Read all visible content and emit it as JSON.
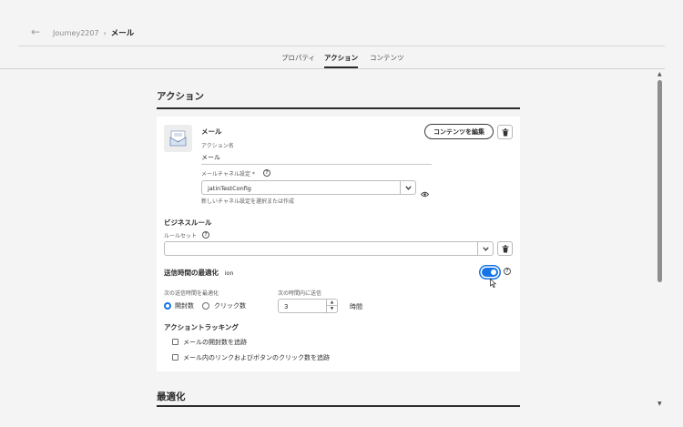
{
  "header": {
    "back_icon": "arrow-left-icon",
    "breadcrumb_parent": "Journey2207",
    "breadcrumb_sep": "›",
    "breadcrumb_current": "メール"
  },
  "tabs": [
    "プロパティ",
    "アクション",
    "コンテンツ"
  ],
  "active_tab": "アクション",
  "action_section": {
    "title": "アクション",
    "email_title": "メール",
    "action_name_label": "アクション名",
    "action_name_value": "メール",
    "channel_label": "メールチャネル設定",
    "required_mark": "*",
    "channel_value": "jatinTestConfig",
    "channel_helper": "新しいチャネル設定を選択または作成",
    "edit_content_button": "コンテンツを編集",
    "business_rules_title": "ビジネスルール",
    "ruleset_label": "ルールセット",
    "ruleset_value": "",
    "send_time_title": "送信時間の最適化",
    "send_time_toggle_label": "ion",
    "send_time_enabled": true,
    "optimize_by_label": "次の送信時間を最適化",
    "option_opens": "開封数",
    "option_clicks": "クリック数",
    "selected_option": "開封数",
    "send_within_label": "次の時間内に送信",
    "send_within_value": "3",
    "send_within_unit": "時間",
    "tracking_title": "アクショントラッキング",
    "track_opens_label": "メールの開封数を追跡",
    "track_clicks_label": "メール内のリンクおよびボタンのクリック数を追跡",
    "track_opens_checked": false,
    "track_clicks_checked": false
  },
  "optimization_section": {
    "title": "最適化"
  },
  "colors": {
    "accent": "#1473e6",
    "background": "#f4f4f4",
    "card": "#ffffff",
    "text": "#2c2c2c"
  }
}
